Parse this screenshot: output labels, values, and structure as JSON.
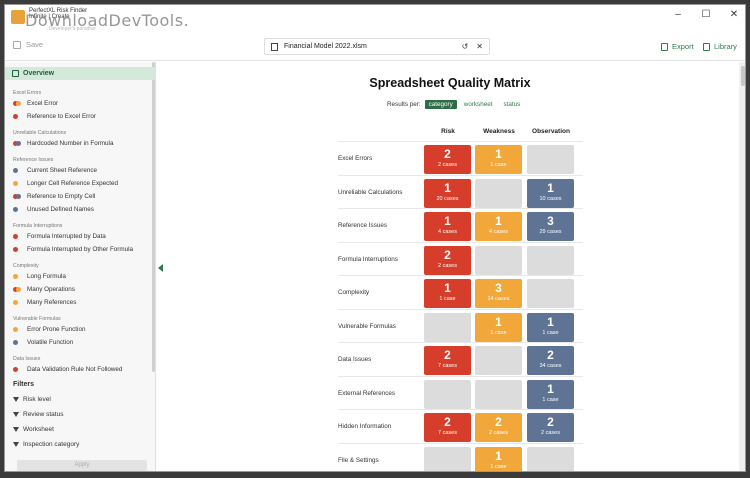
{
  "window": {
    "title": "PerfectXL Risk Finder",
    "subtitle": "Infinite | Create",
    "watermark": "DownloadDevTools.",
    "watermark_sub": "Developer's paradise"
  },
  "toolbar": {
    "save_label": "Save",
    "file_name": "Financial Model 2022.xlsm",
    "export_label": "Export",
    "library_label": "Library"
  },
  "sidebar": {
    "overview_label": "Overview",
    "sections": [
      {
        "title": "Excel Errors",
        "items": [
          {
            "label": "Excel Error",
            "dots": [
              "#d63d2a",
              "#f2a73b"
            ]
          },
          {
            "label": "Reference to Excel Error",
            "dots": [
              "#d63d2a"
            ]
          }
        ]
      },
      {
        "title": "Unreliable Calculations",
        "items": [
          {
            "label": "Hardcoded Number in Formula",
            "dots": [
              "#d63d2a",
              "#5f7394"
            ]
          }
        ]
      },
      {
        "title": "Reference Issues",
        "items": [
          {
            "label": "Current Sheet Reference",
            "dots": [
              "#5f7394"
            ]
          },
          {
            "label": "Longer Cell Reference Expected",
            "dots": [
              "#f2a73b"
            ]
          },
          {
            "label": "Reference to Empty Cell",
            "dots": [
              "#d63d2a",
              "#5f7394"
            ]
          },
          {
            "label": "Unused Defined Names",
            "dots": [
              "#5f7394"
            ]
          }
        ]
      },
      {
        "title": "Formula Interruptions",
        "items": [
          {
            "label": "Formula Interrupted by Data",
            "dots": [
              "#d63d2a"
            ]
          },
          {
            "label": "Formula Interrupted by Other Formula",
            "dots": [
              "#d63d2a"
            ]
          }
        ]
      },
      {
        "title": "Complexity",
        "items": [
          {
            "label": "Long Formula",
            "dots": [
              "#f2a73b"
            ]
          },
          {
            "label": "Many Operations",
            "dots": [
              "#d63d2a",
              "#f2a73b"
            ]
          },
          {
            "label": "Many References",
            "dots": [
              "#f2a73b"
            ]
          }
        ]
      },
      {
        "title": "Vulnerable Formulas",
        "items": [
          {
            "label": "Error Prone Function",
            "dots": [
              "#f2a73b"
            ]
          },
          {
            "label": "Volatile Function",
            "dots": [
              "#5f7394"
            ]
          }
        ]
      },
      {
        "title": "Data Issues",
        "items": [
          {
            "label": "Data Validation Rule Not Followed",
            "dots": [
              "#d63d2a"
            ]
          }
        ]
      }
    ],
    "filters_title": "Filters",
    "filters": [
      "Risk level",
      "Review status",
      "Worksheet",
      "Inspection category"
    ],
    "apply_label": "Apply"
  },
  "main": {
    "title": "Spreadsheet Quality Matrix",
    "results_per_label": "Results per:",
    "results_per_options": [
      "category",
      "worksheet",
      "status"
    ],
    "results_per_selected": "category",
    "columns": [
      "Risk",
      "Weakness",
      "Observation"
    ],
    "rows": [
      {
        "label": "Excel Errors",
        "risk": {
          "count": "2",
          "cases": "2 cases"
        },
        "weakness": {
          "count": "1",
          "cases": "1 case"
        },
        "observation": null
      },
      {
        "label": "Unreliable Calculations",
        "risk": {
          "count": "1",
          "cases": "20 cases"
        },
        "weakness": null,
        "observation": {
          "count": "1",
          "cases": "10 cases"
        }
      },
      {
        "label": "Reference Issues",
        "risk": {
          "count": "1",
          "cases": "4 cases"
        },
        "weakness": {
          "count": "1",
          "cases": "4 cases"
        },
        "observation": {
          "count": "3",
          "cases": "29 cases"
        }
      },
      {
        "label": "Formula Interruptions",
        "risk": {
          "count": "2",
          "cases": "2 cases"
        },
        "weakness": null,
        "observation": null
      },
      {
        "label": "Complexity",
        "risk": {
          "count": "1",
          "cases": "1 case"
        },
        "weakness": {
          "count": "3",
          "cases": "14 cases"
        },
        "observation": null
      },
      {
        "label": "Vulnerable Formulas",
        "risk": null,
        "weakness": {
          "count": "1",
          "cases": "1 case"
        },
        "observation": {
          "count": "1",
          "cases": "1 case"
        }
      },
      {
        "label": "Data Issues",
        "risk": {
          "count": "2",
          "cases": "7 cases"
        },
        "weakness": null,
        "observation": {
          "count": "2",
          "cases": "34 cases"
        }
      },
      {
        "label": "External References",
        "risk": null,
        "weakness": null,
        "observation": {
          "count": "1",
          "cases": "1 case"
        }
      },
      {
        "label": "Hidden Information",
        "risk": {
          "count": "2",
          "cases": "7 cases"
        },
        "weakness": {
          "count": "2",
          "cases": "2 cases"
        },
        "observation": {
          "count": "2",
          "cases": "2 cases"
        }
      },
      {
        "label": "File & Settings",
        "risk": null,
        "weakness": {
          "count": "1",
          "cases": "1 case"
        },
        "observation": null
      }
    ]
  },
  "colors": {
    "accent": "#2e7d4f",
    "risk": "#d63d2a",
    "weakness": "#f2a73b",
    "observation": "#5f7394",
    "empty": "#dcdcdc"
  },
  "icons": [
    "save-icon",
    "file-icon",
    "undo-icon",
    "close-icon",
    "export-icon",
    "library-icon",
    "overview-icon",
    "funnel-icon",
    "collapse-arrow-icon"
  ]
}
